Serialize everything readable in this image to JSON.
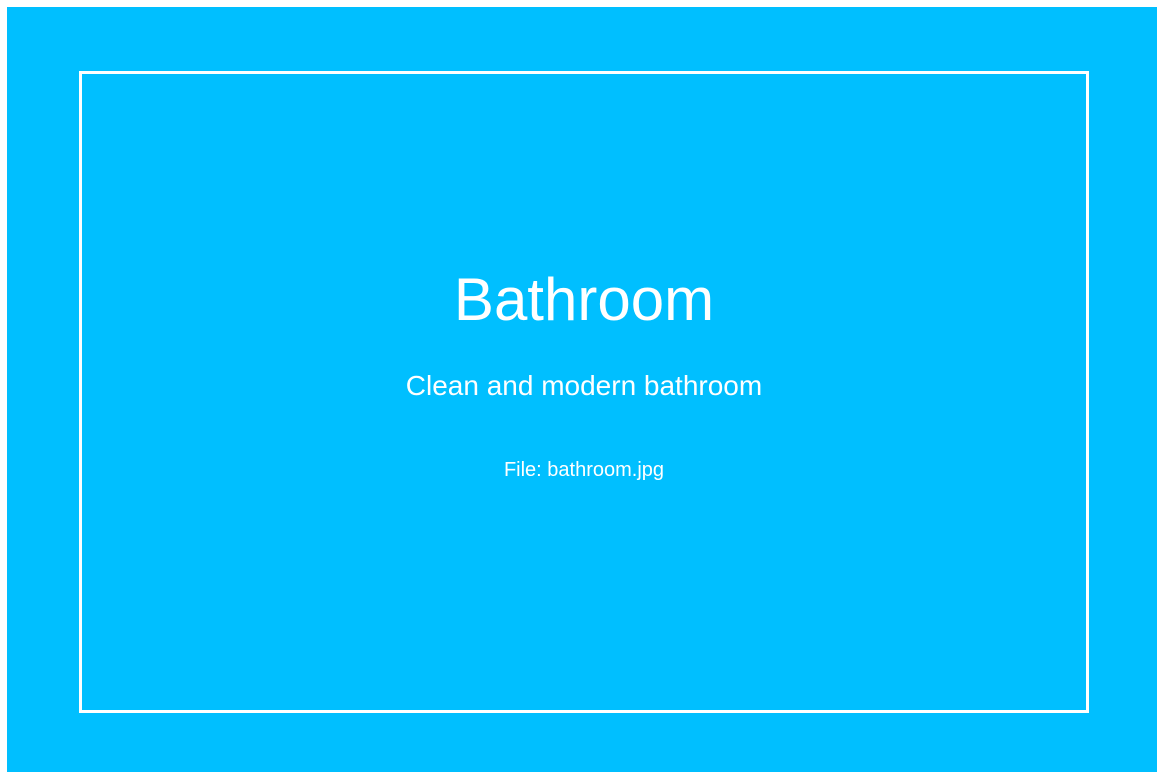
{
  "placeholder": {
    "title": "Bathroom",
    "description": "Clean and modern bathroom",
    "file_label": "File: bathroom.jpg"
  },
  "colors": {
    "background": "#00bfff",
    "frame": "#ffffff",
    "text": "#ffffff"
  }
}
